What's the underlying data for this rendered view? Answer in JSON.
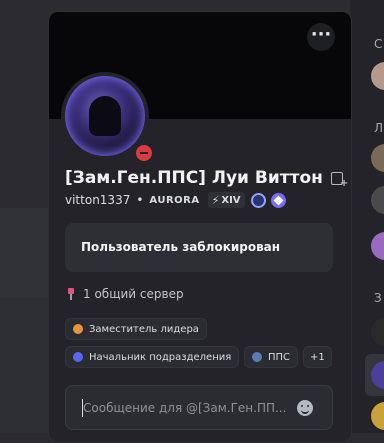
{
  "profile": {
    "display_name": "[Зам.Ген.ППС] Луи Виттон",
    "username": "vitton1337",
    "separator": "•",
    "clan_tag": "AURORA",
    "level_tag": "XIV",
    "status": "do-not-disturb",
    "more_icon": "more-horizontal-icon"
  },
  "blocked": {
    "text": "Пользователь заблокирован"
  },
  "mutual": {
    "servers_text": "1 общий сервер"
  },
  "roles": [
    {
      "label": "Заместитель лидера",
      "color": "#e8943a"
    },
    {
      "label": "Начальник подразделения",
      "color": "#5865f2"
    },
    {
      "label": "ППС",
      "color": "#5b7bb5"
    }
  ],
  "roles_more": "+1",
  "message": {
    "placeholder": "Сообщение для @[Зам.Ген.ПП..."
  },
  "side": {
    "letter_1": "С",
    "letter_2": "Л",
    "letter_3": "З"
  }
}
